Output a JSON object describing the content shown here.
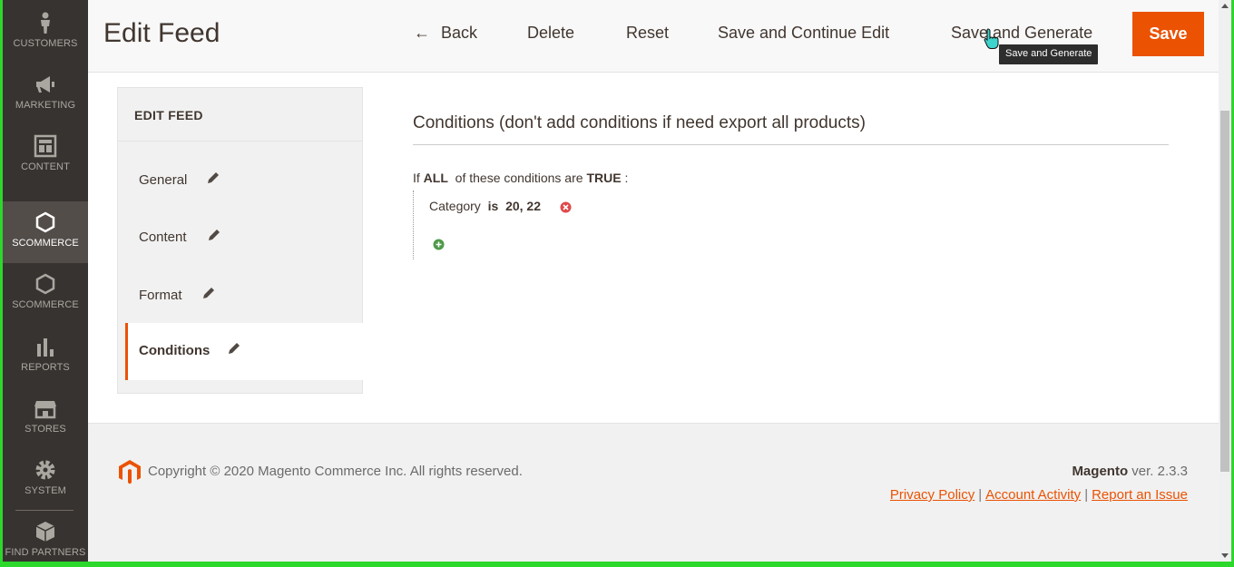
{
  "nav": {
    "items": [
      {
        "label": "CUSTOMERS",
        "icon": "person-icon"
      },
      {
        "label": "MARKETING",
        "icon": "megaphone-icon"
      },
      {
        "label": "CONTENT",
        "icon": "layout-icon"
      },
      {
        "label": "SCOMMERCE",
        "icon": "hexagon-icon"
      },
      {
        "label": "SCOMMERCE",
        "icon": "hexagon-icon"
      },
      {
        "label": "REPORTS",
        "icon": "bar-chart-icon"
      },
      {
        "label": "STORES",
        "icon": "store-icon"
      },
      {
        "label": "SYSTEM",
        "icon": "gear-icon"
      },
      {
        "label": "FIND PARTNERS",
        "icon": "cube-icon"
      }
    ],
    "active_index": 3
  },
  "header": {
    "title": "Edit Feed",
    "back": "Back",
    "delete": "Delete",
    "reset": "Reset",
    "save_continue": "Save and Continue Edit",
    "save_generate": "Save and Generate",
    "save": "Save",
    "tooltip": "Save and Generate"
  },
  "tabs": {
    "title": "EDIT FEED",
    "items": [
      {
        "label": "General"
      },
      {
        "label": "Content"
      },
      {
        "label": "Format"
      },
      {
        "label": "Conditions"
      }
    ],
    "active_index": 3
  },
  "conditions": {
    "title": "Conditions (don't add conditions if need export all products)",
    "prefix": "If",
    "aggregator": "ALL",
    "middle": "of these conditions are",
    "value": "TRUE",
    "suffix": ":",
    "rule": {
      "attribute": "Category",
      "operator": "is",
      "value": "20, 22"
    }
  },
  "footer": {
    "copyright": "Copyright © 2020 Magento Commerce Inc. All rights reserved.",
    "brand": "Magento",
    "version": "ver. 2.3.3",
    "links": [
      "Privacy Policy",
      "Account Activity",
      "Report an Issue"
    ]
  },
  "colors": {
    "accent": "#eb5202",
    "nav_bg": "#373330",
    "nav_active": "#524d49",
    "text": "#41362f"
  }
}
